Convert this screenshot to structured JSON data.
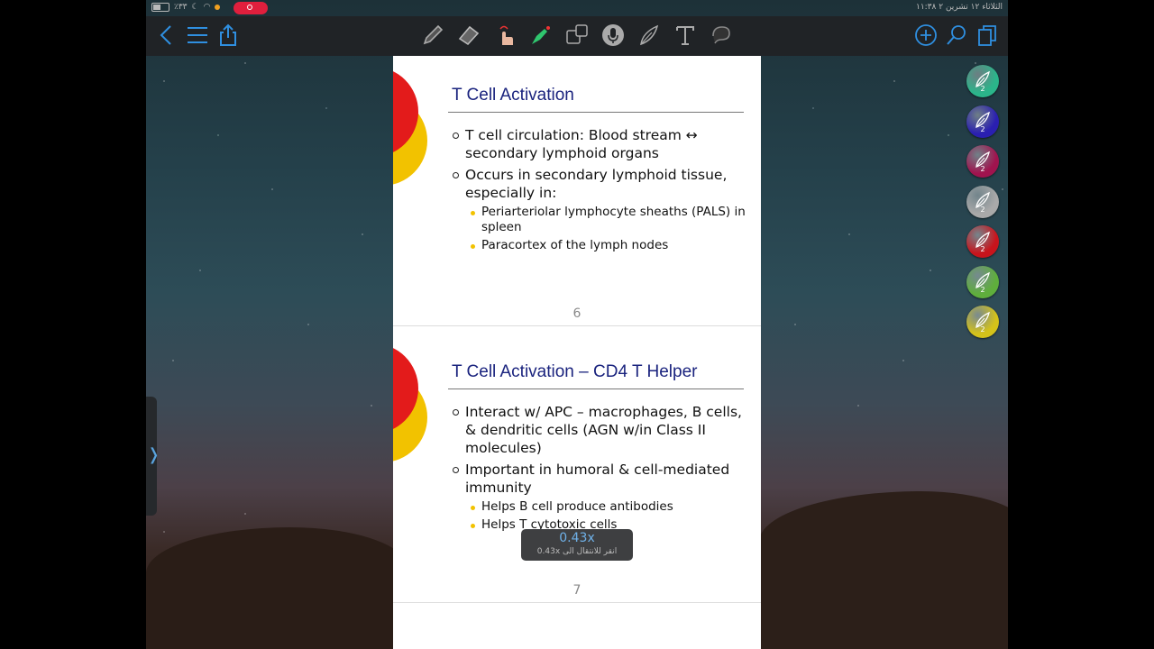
{
  "status_bar": {
    "battery": "٪٣٣",
    "datetime": "الثلاثاء ١٢ تشرين ٢  ١١:٣٨"
  },
  "toolbar": {
    "left_icons": [
      "back-chevron-icon",
      "outline-list-icon",
      "share-icon"
    ],
    "tools": [
      "pen-icon",
      "eraser-icon",
      "hand-pointer-icon",
      "laser-pointer-icon",
      "text-recognition-icon",
      "microphone-icon",
      "feather-pen-icon",
      "text-tool-icon",
      "lasso-icon"
    ],
    "right_icons": [
      "add-icon",
      "search-icon",
      "pages-icon"
    ],
    "accent_color": "#2f8fe0"
  },
  "slides": [
    {
      "title": "T Cell Activation",
      "bullets": [
        {
          "text": "T cell circulation:  Blood stream ↔ secondary lymphoid organs",
          "sub": []
        },
        {
          "text": "Occurs in secondary lymphoid tissue, especially in:",
          "sub": [
            "Periarteriolar lymphocyte sheaths (PALS) in spleen",
            "Paracortex of the lymph nodes"
          ]
        }
      ],
      "page_number": "6"
    },
    {
      "title": "T Cell Activation – CD4 T Helper",
      "bullets": [
        {
          "text": "Interact w/ APC – macrophages, B cells, & dendritic cells (AGN w/in Class II molecules)",
          "sub": []
        },
        {
          "text": "Important in humoral & cell-mediated immunity",
          "sub": [
            "Helps B cell produce antibodies",
            "Helps T cytotoxic cells"
          ]
        }
      ],
      "page_number": "7"
    }
  ],
  "zoom_hud": {
    "value": "0.43x",
    "hint": "انقر للانتقال الى 0.43x"
  },
  "side_tab": {
    "glyph": "❭"
  },
  "pen_palette": [
    {
      "color": "#2bb58a",
      "level": "2"
    },
    {
      "color": "#2a1fb0",
      "level": "2"
    },
    {
      "color": "#a0134e",
      "level": "2"
    },
    {
      "color": "#a9a9a9",
      "level": "2"
    },
    {
      "color": "#c8141c",
      "level": "2"
    },
    {
      "color": "#5fae3c",
      "level": "2"
    },
    {
      "color": "#d4c21a",
      "level": "2"
    }
  ]
}
